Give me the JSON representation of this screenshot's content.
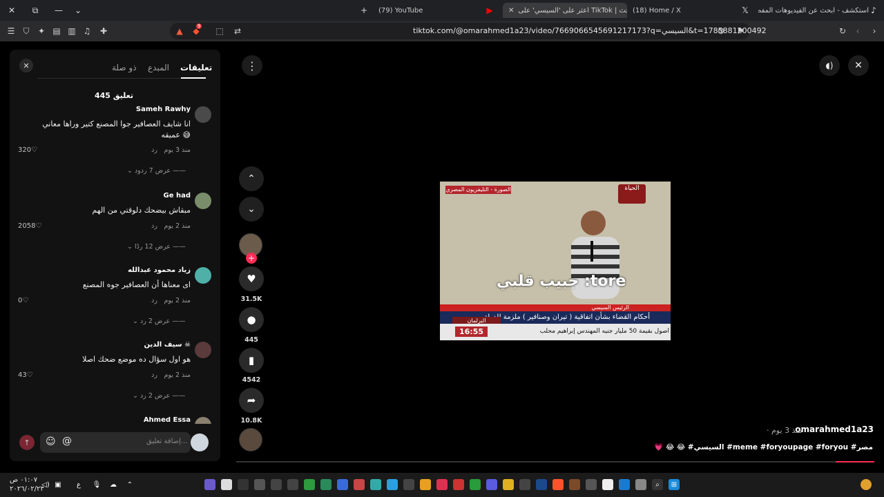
{
  "browser": {
    "tabs": [
      {
        "label": "استكشف - ابحث عن الفيديوهات المفضلة"
      },
      {
        "label": "(18) Home / X"
      },
      {
        "label": "اعثر على 'السيسي' على TikTok | بحث"
      },
      {
        "label": "(79) YouTube"
      }
    ],
    "url": "tiktok.com/@omarahmed1a23/video/7669066545691217173?q=السيسي&t=1785881200492",
    "shield_badge": "9"
  },
  "comments_panel": {
    "tabs": [
      "تعليقات",
      "المبدع",
      "ذو صلة"
    ],
    "count_label": "445 تعليق",
    "comments": [
      {
        "author": "Sameh Rawhy",
        "text": "انا شايف العصافير جوا المصنع كتير وراها معاني عميقه 😅",
        "time": "منذ 3 يوم",
        "reply": "رد",
        "likes": "320",
        "view_replies": "عرض 7 ردود"
      },
      {
        "author": "Ge had",
        "text": "مبقاش بيضحك دلوقتي من الهم",
        "time": "منذ 2 يوم",
        "reply": "رد",
        "likes": "2058",
        "view_replies": "عرض 12 ردًا"
      },
      {
        "author": "زياد محمود عبدالله",
        "text": "اى معناها أن العصافير جوه المصنع",
        "time": "منذ 2 يوم",
        "reply": "رد",
        "likes": "0",
        "view_replies": "عرض 2 رد"
      },
      {
        "author": "سيف الدين ☠",
        "text": "هو اول سؤال ده موضع ضحك اصلا",
        "time": "منذ 2 يوم",
        "reply": "رد",
        "likes": "43",
        "view_replies": "عرض 2 رد"
      },
      {
        "author": "Ahmed Essa",
        "text": "",
        "time": "",
        "reply": "",
        "likes": "",
        "view_replies": ""
      }
    ],
    "add_placeholder": "إضافة تعليق..."
  },
  "actions": {
    "likes": "31.5K",
    "comments": "445",
    "saves": "4542",
    "shares": "10.8K"
  },
  "video": {
    "overlay_top_label": "الصورة - التليفزيون المصري",
    "channel_logo": "الحياة",
    "caption": "جبيب قلبي :tore",
    "title_bar": "الرئيس السيسي",
    "lower_text": "أحكام القضاء بشأن اتفاقية ( تيران وصنافير ) ملزمة للدولة",
    "lower_label": "البرلمان",
    "time": "16:55",
    "ticker": "أصول بقيمة 50 مليار جنيه    المهندس إبراهيم محلب"
  },
  "post": {
    "author": "omarahmed1a23",
    "date": "· منذ 3 يوم",
    "description": "💗 😂 😂 #السيسي #meme #foryoupage #foryou #مصر"
  },
  "taskbar": {
    "time": "٠١:٠٧ ص",
    "date": "٢٠٢٦/٠٢/٢٣",
    "lang": "ع"
  },
  "colors": {
    "accent": "#fe2c55",
    "panel": "#121212"
  }
}
